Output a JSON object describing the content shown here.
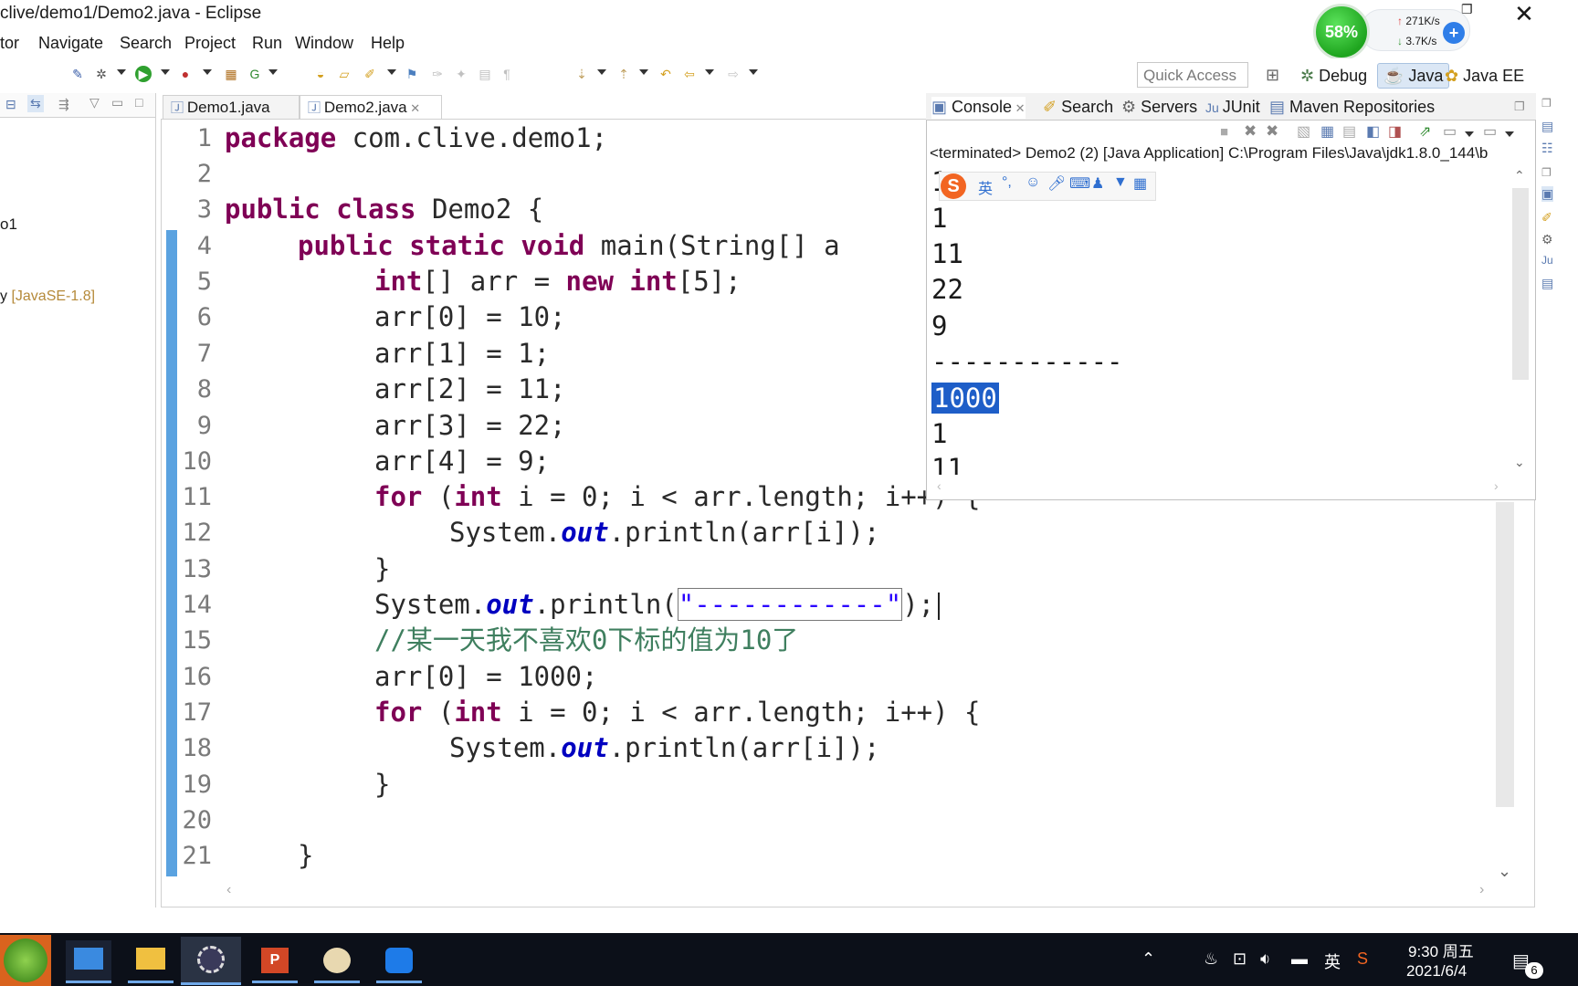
{
  "window": {
    "title": "clive/demo1/Demo2.java - Eclipse"
  },
  "menu": [
    "tor",
    "Navigate",
    "Search",
    "Project",
    "Run",
    "Window",
    "Help"
  ],
  "quick_access_placeholder": "Quick Access",
  "perspectives": [
    "Debug",
    "Java",
    "Java EE"
  ],
  "network_widget": {
    "percent": "58%",
    "up": "271K/s",
    "down": "3.7K/s"
  },
  "left_pane": {
    "item1": "o1",
    "item2_prefix": "y",
    "item2_suffix": "[JavaSE-1.8]"
  },
  "editor_tabs": [
    "Demo1.java",
    "Demo2.java"
  ],
  "code_lines": [
    {
      "n": "1"
    },
    {
      "n": "2"
    },
    {
      "n": "3"
    },
    {
      "n": "4"
    },
    {
      "n": "5"
    },
    {
      "n": "6"
    },
    {
      "n": "7"
    },
    {
      "n": "8"
    },
    {
      "n": "9"
    },
    {
      "n": "10"
    },
    {
      "n": "11"
    },
    {
      "n": "12"
    },
    {
      "n": "13"
    },
    {
      "n": "14"
    },
    {
      "n": "15"
    },
    {
      "n": "16"
    },
    {
      "n": "17"
    },
    {
      "n": "18"
    },
    {
      "n": "19"
    },
    {
      "n": "20"
    },
    {
      "n": "21"
    }
  ],
  "code": {
    "l1_kw": "package",
    "l1_rest": " com.clive.demo1;",
    "l3_kw": "public class",
    "l3_rest": " Demo2 {",
    "l4_kw": "public static void",
    "l4_rest": " main(String[] a",
    "l5_kw1": "int",
    "l5_mid": "[] arr = ",
    "l5_kw2": "new int",
    "l5_rest": "[5];",
    "l6": "arr[0] = 10;",
    "l7": "arr[1] = 1;",
    "l8": "arr[2] = 11;",
    "l9": "arr[3] = 22;",
    "l10": "arr[4] = 9;",
    "l11_kw1": "for",
    "l11_mid1": " (",
    "l11_kw2": "int",
    "l11_rest": " i = 0; i < arr.length; i++) {",
    "l12_pre": "System.",
    "l12_fld": "out",
    "l12_rest": ".println(arr[i]);",
    "l13": "}",
    "l14_pre": "System.",
    "l14_fld": "out",
    "l14_mid": ".println(",
    "l14_str": "\"------------\"",
    "l14_rest": ");",
    "l15": "//某一天我不喜欢0下标的值为10了",
    "l16": "arr[0] = 1000;",
    "l17_kw1": "for",
    "l17_mid1": " (",
    "l17_kw2": "int",
    "l17_rest": " i = 0; i < arr.length; i++) {",
    "l18_pre": "System.",
    "l18_fld": "out",
    "l18_rest": ".println(arr[i]);",
    "l19": "}",
    "l21": "}"
  },
  "console": {
    "tabs": [
      "Console",
      "Search",
      "Servers",
      "JUnit",
      "Maven Repositories"
    ],
    "status": "<terminated> Demo2 (2) [Java Application] C:\\Program Files\\Java\\jdk1.8.0_144\\b",
    "lines": [
      "1",
      "1",
      "11",
      "22",
      "9",
      "------------",
      "1000",
      "1",
      "11"
    ]
  },
  "ime_label": "英",
  "taskbar": {
    "time": "9:30 周五",
    "date": "2021/6/4",
    "ime": "英",
    "notif_count": "6"
  }
}
